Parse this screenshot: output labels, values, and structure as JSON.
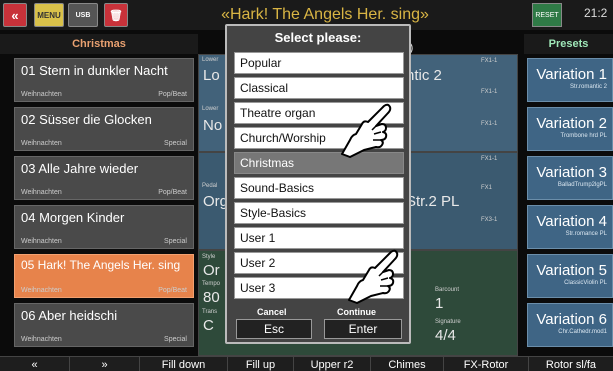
{
  "topbar": {
    "back_icon": "«",
    "menu_icon": "MENU",
    "usb_icon": "USB",
    "trash_icon": "🗑",
    "song_title": "«Hark! The Angels Her. sing»",
    "reset_icon": "RESET",
    "clock": "21:2"
  },
  "header": {
    "left_label": "Christmas",
    "right_label": "Presets"
  },
  "songs": [
    {
      "name": "01 Stern in dunkler Nacht",
      "category": "Weihnachten",
      "style": "Pop/Beat"
    },
    {
      "name": "02 Süsser die Glocken",
      "category": "Weihnachten",
      "style": "Special"
    },
    {
      "name": "03 Alle Jahre wieder",
      "category": "Weihnachten",
      "style": "Pop/Beat"
    },
    {
      "name": "04 Morgen Kinder",
      "category": "Weihnachten",
      "style": "Special"
    },
    {
      "name": "05 Hark! The Angels Her. sing",
      "category": "Weihnachten",
      "style": "Pop/Beat"
    },
    {
      "name": "06 Aber heidschi",
      "category": "Weihnachten",
      "style": "Special"
    }
  ],
  "middle": {
    "row1_text": "ntic 2",
    "row4_text": "Str.2 PL",
    "lower_label": "Lower",
    "pedal_label": "Pedal",
    "style_label": "Style",
    "tempo_label": "Tempo",
    "trans_label": "Trans",
    "fx_labels": [
      "FX1-1",
      "FX1-1",
      "FX1-1",
      "FX1-1",
      "FX1",
      "FX3-1"
    ],
    "barcount_label": "Barcount",
    "barcount_value": "1",
    "signature_label": "Signature",
    "signature_value": "4/4",
    "row5_value": "Or",
    "row6_value": "80",
    "row7_value": "C",
    "lo_text": "Lo",
    "no_text": "No",
    "org_text": "Org",
    "tab_fragment": "-)"
  },
  "presets": [
    {
      "name": "Variation 1",
      "sub": "Str.romantic 2"
    },
    {
      "name": "Variation 2",
      "sub": "Trombone hrd PL"
    },
    {
      "name": "Variation 3",
      "sub": "BalladTrump2lgPL"
    },
    {
      "name": "Variation 4",
      "sub": "Str.romance PL"
    },
    {
      "name": "Variation 5",
      "sub": "ClassicViolin PL"
    },
    {
      "name": "Variation 6",
      "sub": "Chr.Cathedr.mod1"
    }
  ],
  "bottombar": [
    "«",
    "»",
    "Fill down",
    "Fill up",
    "Upper r2",
    "Chimes",
    "FX-Rotor",
    "Rotor sl/fa"
  ],
  "dialog": {
    "title": "Select please:",
    "options": [
      "Popular",
      "Classical",
      "Theatre organ",
      "Church/Worship",
      "Christmas",
      "Sound-Basics",
      "Style-Basics",
      "User 1",
      "User 2",
      "User 3"
    ],
    "selected": "Christmas",
    "cancel_label": "Cancel",
    "cancel_button": "Esc",
    "continue_label": "Continue",
    "continue_button": "Enter"
  },
  "colors": {
    "accent_orange": "#e7834b",
    "preset_blue": "#3f6585",
    "title_gold": "#d9b544",
    "presets_header": "#9fe7b8"
  },
  "icons": {
    "hand_pointer_1": "hand-pointer-icon",
    "hand_pointer_2": "hand-pointer-icon"
  }
}
